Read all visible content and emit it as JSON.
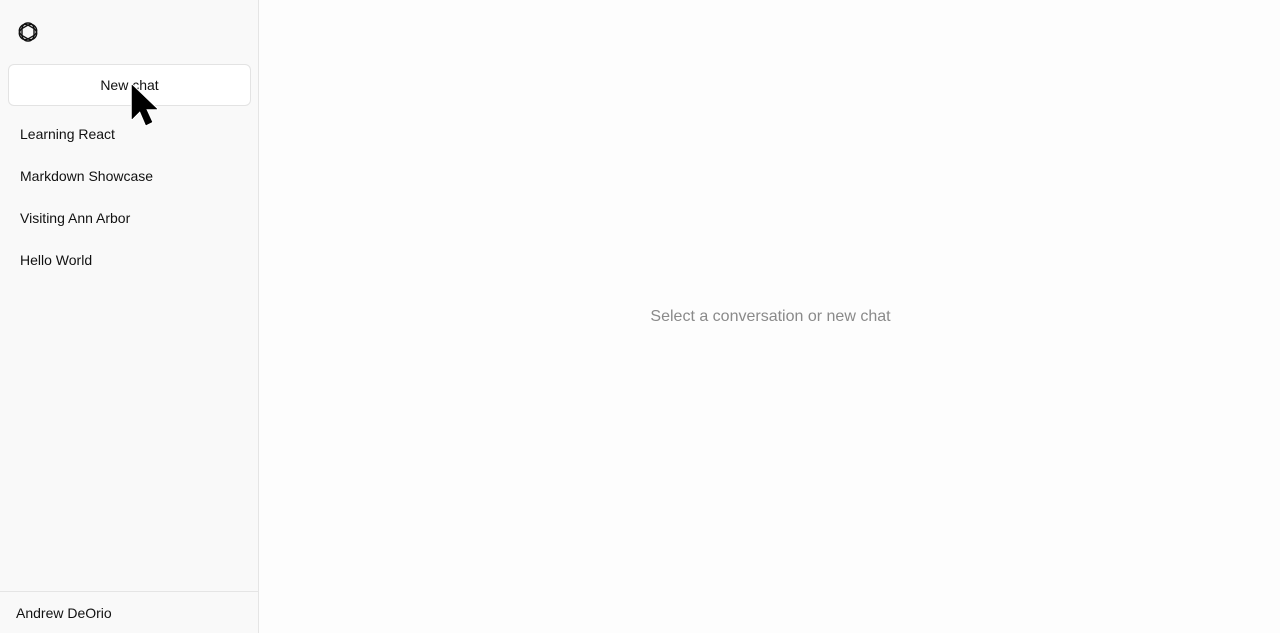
{
  "sidebar": {
    "new_chat_label": "New chat",
    "conversations": [
      {
        "label": "Learning React"
      },
      {
        "label": "Markdown Showcase"
      },
      {
        "label": "Visiting Ann Arbor"
      },
      {
        "label": "Hello World"
      }
    ],
    "user_name": "Andrew DeOrio"
  },
  "main": {
    "empty_state_text": "Select a conversation or new chat"
  },
  "icons": {
    "logo": "openai-logo-icon",
    "cursor": "mouse-pointer-icon"
  },
  "colors": {
    "sidebar_bg": "#f9f9f9",
    "main_bg": "#fdfdfd",
    "muted_text": "#8a8a8a",
    "border": "#e5e5e5"
  }
}
